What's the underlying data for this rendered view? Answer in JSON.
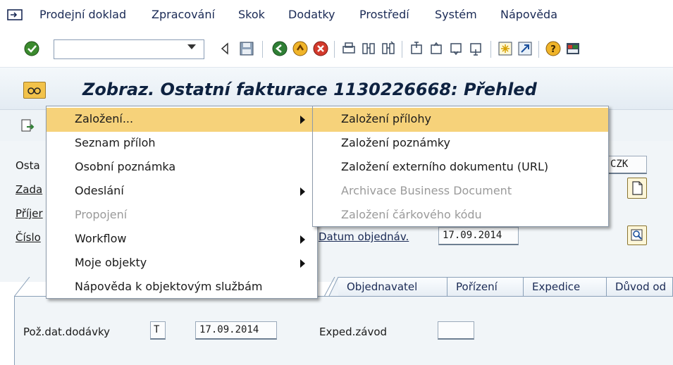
{
  "menubar": {
    "items": [
      {
        "label": "Prodejní doklad"
      },
      {
        "label": "Zpracování"
      },
      {
        "label": "Skok"
      },
      {
        "label": "Dodatky"
      },
      {
        "label": "Prostředí"
      },
      {
        "label": "Systém"
      },
      {
        "label": "Nápověda"
      }
    ]
  },
  "toolbar": {
    "command_value": ""
  },
  "title": {
    "text": "Zobraz. Ostatní fakturace 1130226668: Přehled"
  },
  "form": {
    "labels": {
      "ostat": "Osta",
      "zadat": "Zada",
      "prijem": "Příjer",
      "cislo": "Číslo",
      "datum_obj": "Datum objednáv.",
      "poz_dat": "Pož.dat.dodávky",
      "exped_zavod": "Exped.závod"
    },
    "values": {
      "currency": "CZK",
      "datum_obj": "17.09.2014",
      "poz_dat_type": "T",
      "poz_dat": "17.09.2014",
      "exped_zavod": ""
    }
  },
  "tabs": [
    {
      "label": "Objednavatel"
    },
    {
      "label": "Pořízení"
    },
    {
      "label": "Expedice"
    },
    {
      "label": "Důvod od"
    }
  ],
  "context_menu": {
    "items": [
      {
        "label": "Založení...",
        "has_submenu": true,
        "highlighted": true,
        "disabled": false
      },
      {
        "label": "Seznam příloh",
        "has_submenu": false,
        "highlighted": false,
        "disabled": false
      },
      {
        "label": "Osobní poznámka",
        "has_submenu": false,
        "highlighted": false,
        "disabled": false
      },
      {
        "label": "Odeslání",
        "has_submenu": true,
        "highlighted": false,
        "disabled": false
      },
      {
        "label": "Propojení",
        "has_submenu": false,
        "highlighted": false,
        "disabled": true
      },
      {
        "label": "Workflow",
        "has_submenu": true,
        "highlighted": false,
        "disabled": false
      },
      {
        "label": "Moje objekty",
        "has_submenu": true,
        "highlighted": false,
        "disabled": false
      },
      {
        "label": "Nápověda k objektovým službám",
        "has_submenu": false,
        "highlighted": false,
        "disabled": false
      }
    ]
  },
  "submenu": {
    "items": [
      {
        "label": "Založení přílohy",
        "highlighted": true,
        "disabled": false
      },
      {
        "label": "Založení poznámky",
        "highlighted": false,
        "disabled": false
      },
      {
        "label": "Založení externího dokumentu (URL)",
        "highlighted": false,
        "disabled": false
      },
      {
        "label": "Archivace Business Document",
        "highlighted": false,
        "disabled": true
      },
      {
        "label": "Založení čárkového kódu",
        "highlighted": false,
        "disabled": true
      }
    ]
  },
  "colors": {
    "menu_highlight": "#f6d27a",
    "title_text": "#0e2240",
    "disabled_text": "#9a9a9a"
  }
}
